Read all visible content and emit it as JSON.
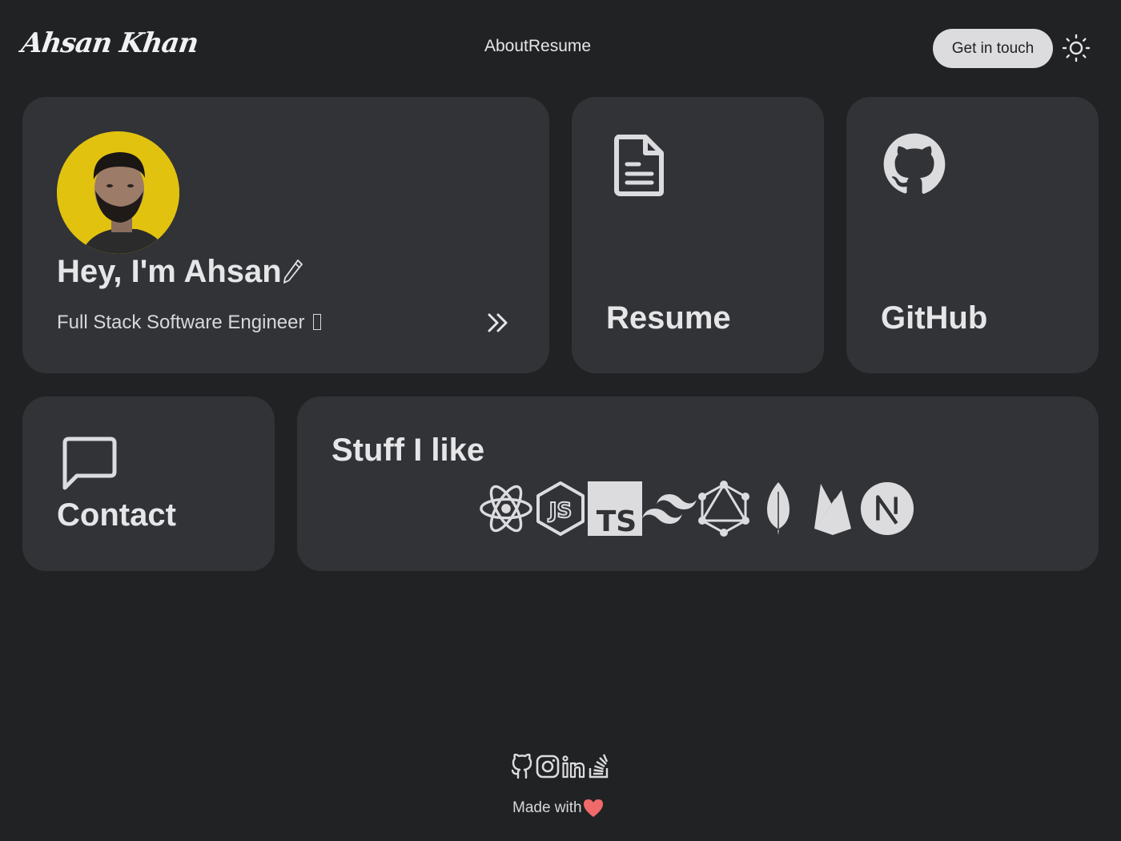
{
  "header": {
    "logo": "Ahsan Khan",
    "nav": [
      {
        "label": "About"
      },
      {
        "label": "Resume"
      }
    ],
    "cta_label": "Get in touch",
    "theme_icon": "sun-icon"
  },
  "hero": {
    "title": "Hey, I'm Ahsan",
    "title_icon": "pencil-icon",
    "subtitle": "Full Stack Software Engineer",
    "arrow_icon": "double-chevron-right-icon",
    "avatar_bg": "#e1c20f"
  },
  "cards": {
    "resume": {
      "label": "Resume",
      "icon": "document-icon"
    },
    "github": {
      "label": "GitHub",
      "icon": "github-icon"
    },
    "contact": {
      "label": "Contact",
      "icon": "chat-bubble-icon"
    }
  },
  "stuff": {
    "title": "Stuff I like",
    "icons": [
      "react-icon",
      "nodejs-icon",
      "typescript-icon",
      "tailwind-icon",
      "graphql-icon",
      "mongodb-icon",
      "firebase-icon",
      "nextjs-icon"
    ]
  },
  "footer": {
    "socials": [
      "github-icon",
      "instagram-icon",
      "linkedin-icon",
      "stackoverflow-icon"
    ],
    "made_with": "Made with",
    "heart_color": "#f06a6a"
  },
  "colors": {
    "background": "#212224",
    "card": "#313336",
    "text": "#e6e6e8",
    "cta_bg": "#dcdcdf"
  }
}
